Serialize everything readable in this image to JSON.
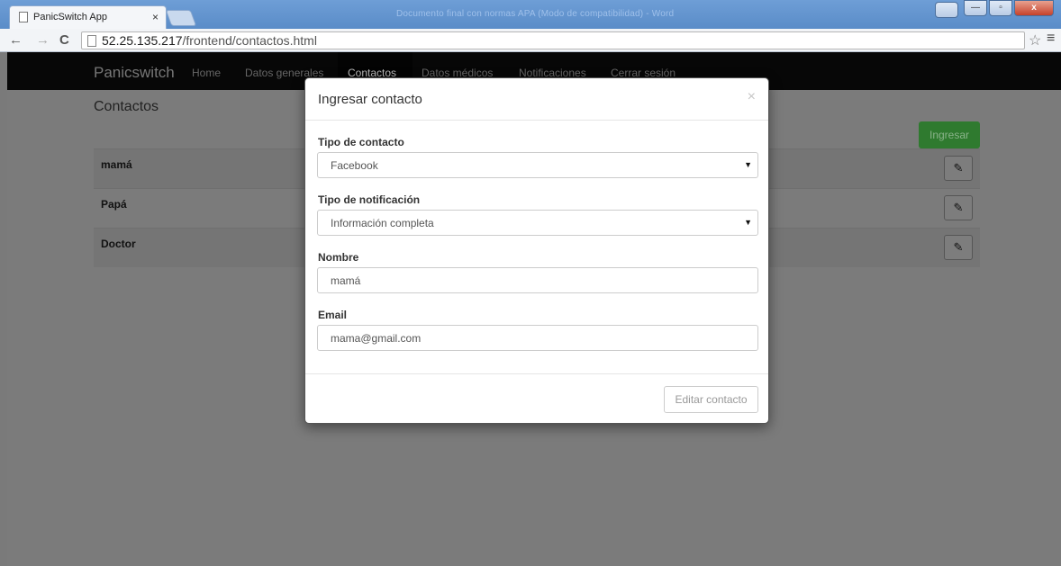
{
  "browser": {
    "tab_title": "PanicSwitch App",
    "tab_close": "×",
    "faded_window_title": "Documento final con normas APA (Modo de compatibilidad) - Word",
    "url_host": "52.25.135.217",
    "url_path": "/frontend/contactos.html",
    "back_icon": "←",
    "forward_icon": "→",
    "reload_icon": "C",
    "star_icon": "☆",
    "menu_icon": "≡",
    "win_min": "—",
    "win_max": "▫",
    "win_close": "x",
    "win_user": "👤"
  },
  "navbar": {
    "brand": "Panicswitch",
    "links": [
      "Home",
      "Datos generales",
      "Contactos",
      "Datos médicos",
      "Notificaciones",
      "Cerrar sesión"
    ],
    "active": "Contactos"
  },
  "page": {
    "title": "Contactos",
    "add_button": "Ingresar",
    "contacts": [
      "mamá",
      "Papá",
      "Doctor"
    ],
    "edit_icon": "✎"
  },
  "modal": {
    "title": "Ingresar contacto",
    "close": "×",
    "tipo_contacto_label": "Tipo de contacto",
    "tipo_contacto_value": "Facebook",
    "tipo_notificacion_label": "Tipo de notificación",
    "tipo_notificacion_value": "Información completa",
    "nombre_label": "Nombre",
    "nombre_value": "mamá",
    "email_label": "Email",
    "email_value": "mama@gmail.com",
    "submit": "Editar contacto"
  },
  "colors": {
    "navbar_bg": "#070707",
    "success_button": "#2f7a2f",
    "backdrop": "#7b7b7b"
  }
}
